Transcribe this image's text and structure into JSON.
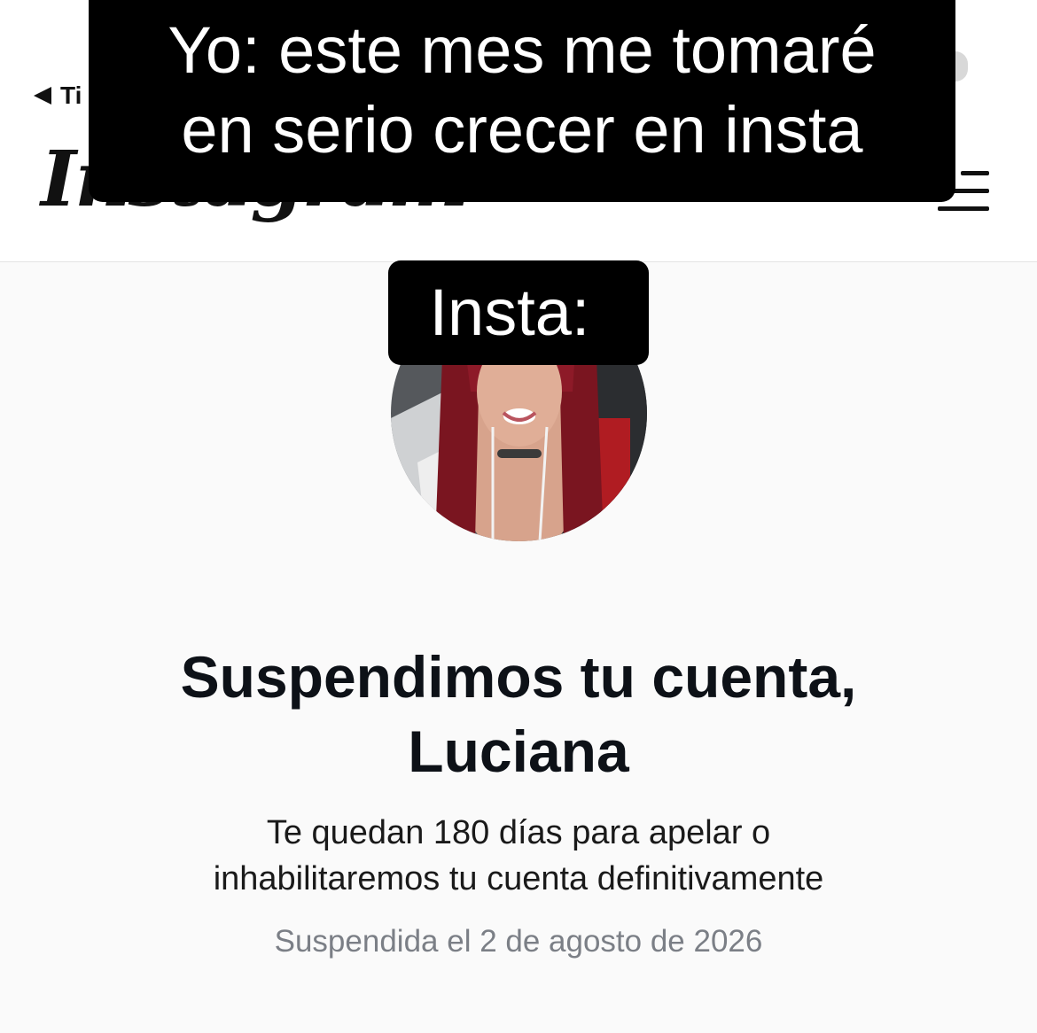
{
  "caption": {
    "top_line1": "Yo: este mes me tomaré",
    "top_line2": "en serio crecer en insta",
    "middle": "Insta:"
  },
  "header": {
    "back_label": "Ti",
    "logo_text": "Instagram",
    "menu_icon": "hamburger-menu-icon"
  },
  "profile": {
    "avatar_icon": "profile-photo"
  },
  "notice": {
    "title_line1": "Suspendimos tu cuenta,",
    "title_line2": "Luciana",
    "message_line1": "Te quedan 180 días para apelar o",
    "message_line2": "inhabilitaremos tu cuenta definitivamente",
    "date": "Suspendida el 2 de agosto de 2026"
  },
  "colors": {
    "background": "#fafafa",
    "header_bg": "#ffffff",
    "caption_bg": "#000000",
    "caption_text": "#ffffff",
    "title": "#0d1117",
    "muted": "#7b7f86"
  }
}
